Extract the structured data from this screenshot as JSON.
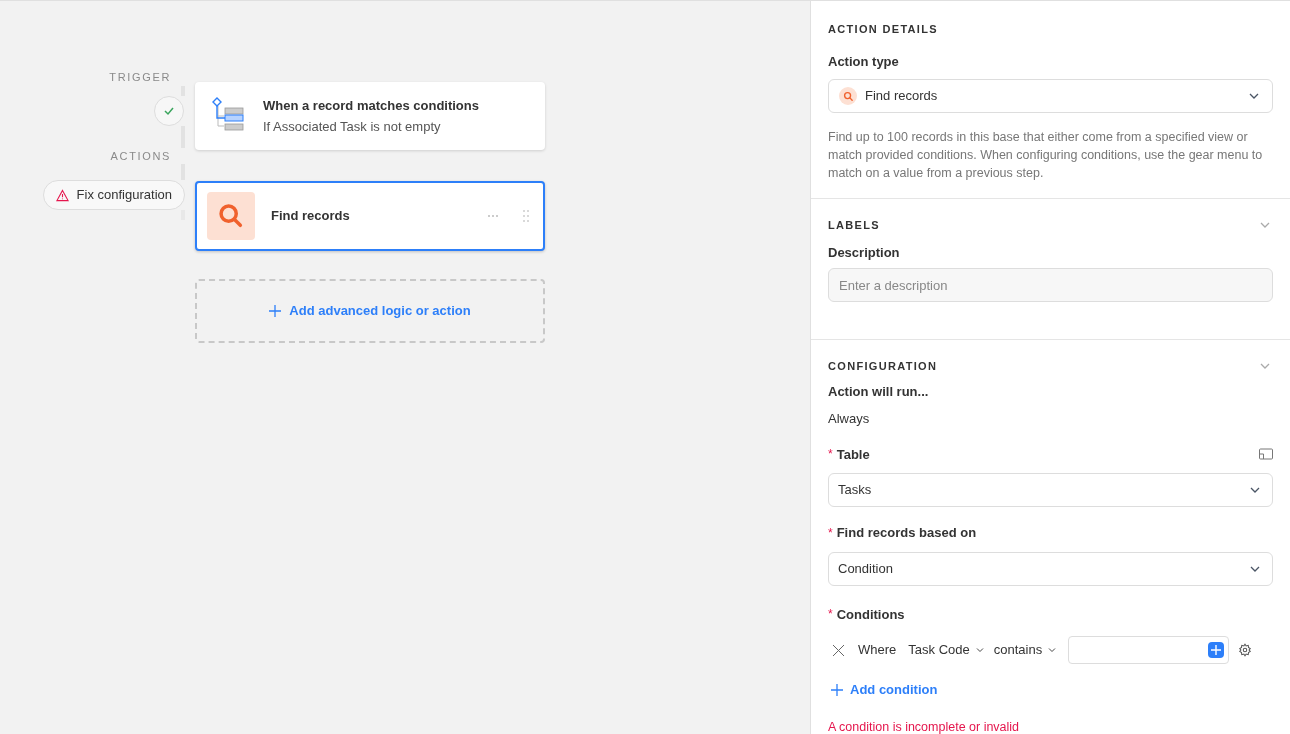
{
  "canvas": {
    "trigger": {
      "section_label": "TRIGGER",
      "checked": true,
      "title": "When a record matches conditions",
      "subtitle": "If Associated Task is not empty"
    },
    "actions": {
      "section_label": "ACTIONS",
      "warning": "Fix configuration",
      "items": [
        {
          "title": "Find records",
          "selected": true
        }
      ]
    },
    "add_button": "Add advanced logic or action"
  },
  "panel": {
    "action_details": {
      "heading": "ACTION DETAILS",
      "type_label": "Action type",
      "type_value": "Find records",
      "description": "Find up to 100 records in this base that either come from a specified view or match provided conditions. When configuring conditions, use the gear menu to match on a value from a previous step."
    },
    "labels": {
      "heading": "LABELS",
      "description_label": "Description",
      "description_placeholder": "Enter a description"
    },
    "configuration": {
      "heading": "CONFIGURATION",
      "run_label": "Action will run...",
      "run_value": "Always",
      "fields": [
        {
          "label": "Table",
          "required_mark": "*",
          "value": "Tasks",
          "side_icon": true
        },
        {
          "label": "Find records based on",
          "required_mark": "*",
          "value": "Condition",
          "side_icon": false
        }
      ],
      "conditions_label": "Conditions",
      "conditions_required_mark": "*",
      "condition": {
        "prefix": "Where",
        "field": "Task Code",
        "operator": "contains"
      },
      "add_condition": "Add condition",
      "error": "A condition is incomplete or invalid"
    }
  }
}
